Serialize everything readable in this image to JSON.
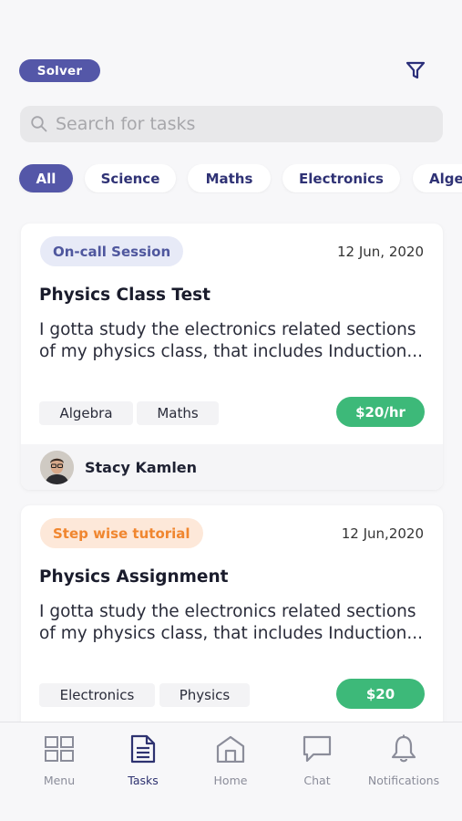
{
  "header": {
    "role_badge": "Solver",
    "filter_icon": "filter-icon"
  },
  "search": {
    "placeholder": "Search for tasks",
    "value": "",
    "icon": "search-icon"
  },
  "categories": [
    {
      "label": "All",
      "active": true
    },
    {
      "label": "Science",
      "active": false
    },
    {
      "label": "Maths",
      "active": false
    },
    {
      "label": "Electronics",
      "active": false
    },
    {
      "label": "Alge",
      "active": false
    }
  ],
  "tasks": [
    {
      "type": "On-call Session",
      "type_color": "#4f579e",
      "date": "12 Jun, 2020",
      "title": "Physics Class Test",
      "description": "I gotta study the electronics related sections of my physics class, that includes Induction...",
      "tags": [
        "Algebra",
        "Maths"
      ],
      "price": "$20/hr",
      "author": "Stacy Kamlen"
    },
    {
      "type": "Step wise tutorial",
      "type_color": "#f0862f",
      "date": "12 Jun,2020",
      "title": "Physics Assignment",
      "description": "I gotta study the electronics related sections of my physics class, that includes Induction...",
      "tags": [
        "Electronics",
        "Physics"
      ],
      "price": "$20"
    }
  ],
  "bottom_nav": [
    {
      "label": "Menu",
      "icon": "grid-icon",
      "active": false
    },
    {
      "label": "Tasks",
      "icon": "document-icon",
      "active": true
    },
    {
      "label": "Home",
      "icon": "home-icon",
      "active": false
    },
    {
      "label": "Chat",
      "icon": "chat-icon",
      "active": false
    },
    {
      "label": "Notifications",
      "icon": "bell-icon",
      "active": false
    }
  ],
  "colors": {
    "accent": "#5457a8",
    "price_green": "#3db979",
    "background": "#f7f7f9"
  }
}
